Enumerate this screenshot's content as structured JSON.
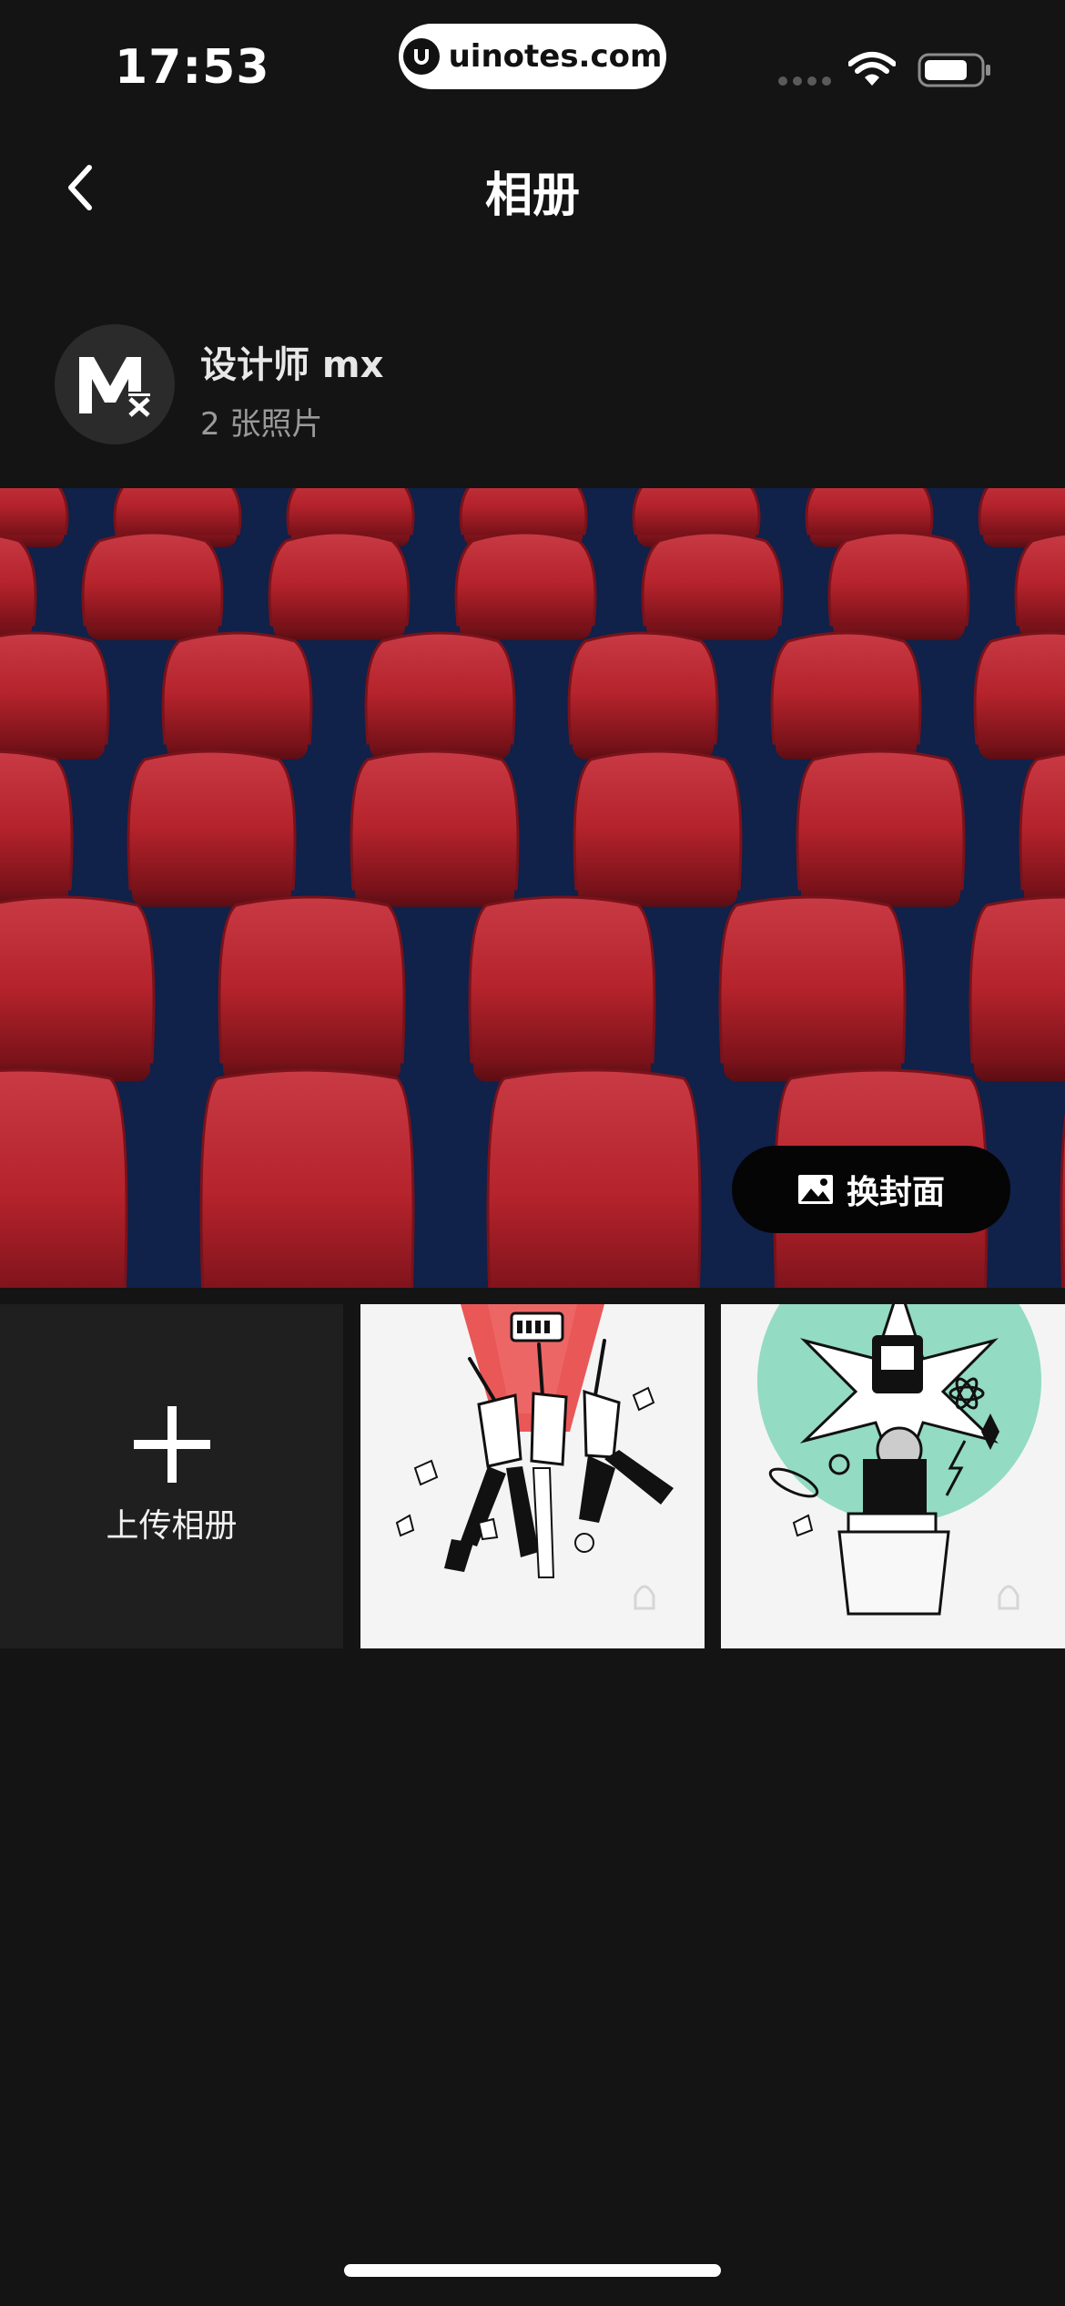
{
  "status_bar": {
    "time": "17:53",
    "url": "uinotes.com",
    "icons": [
      "signal-icon",
      "wifi-icon",
      "battery-icon"
    ]
  },
  "header": {
    "title": "相册",
    "back_icon": "chevron-left-icon"
  },
  "owner": {
    "name": "设计师 mx",
    "photo_count": "2 张照片",
    "avatar_icon": "mx-logo-avatar"
  },
  "cover": {
    "change_cover_label": "换封面",
    "change_cover_icon": "image-icon"
  },
  "grid": {
    "upload_label": "上传相册",
    "upload_icon": "plus-icon",
    "photos": [
      {
        "name": "illustration-people-reaching"
      },
      {
        "name": "illustration-folder-burst"
      }
    ]
  },
  "colors": {
    "background": "#141414",
    "tile": "#1f1f1f",
    "seat_red": "#b5232c",
    "accent_green": "#6fcfae"
  }
}
